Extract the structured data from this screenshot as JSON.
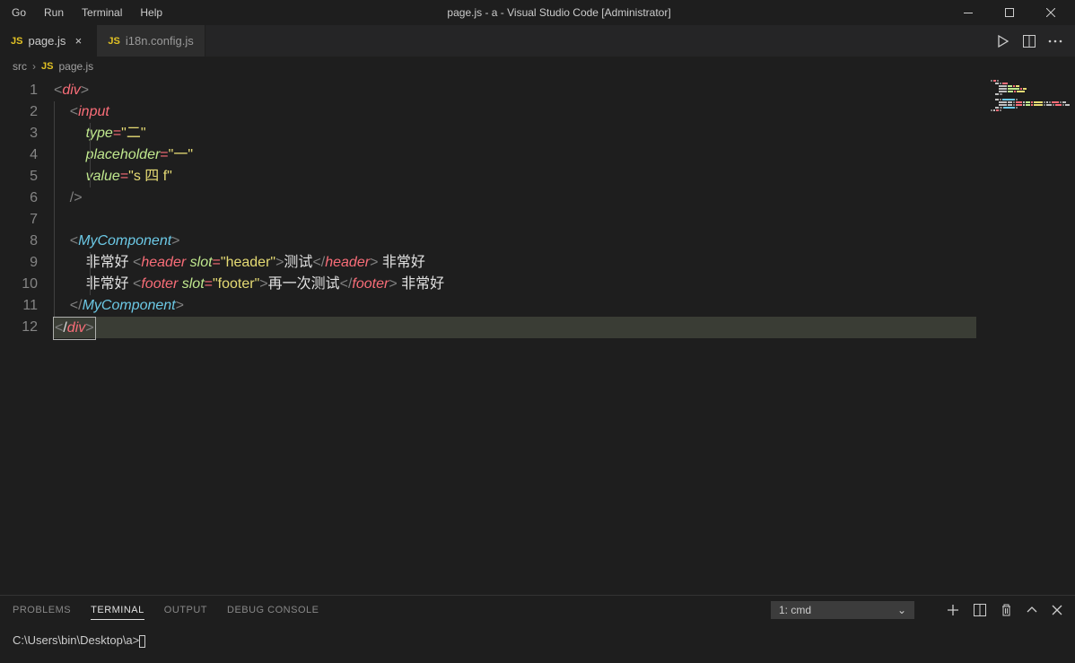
{
  "menubar": {
    "items": [
      "Go",
      "Run",
      "Terminal",
      "Help"
    ],
    "title": "page.js - a - Visual Studio Code [Administrator]"
  },
  "tabs": [
    {
      "icon": "JS",
      "label": "page.js",
      "active": true,
      "dirty": false
    },
    {
      "icon": "JS",
      "label": "i18n.config.js",
      "active": false,
      "dirty": false
    }
  ],
  "breadcrumb": {
    "root": "src",
    "file": "page.js",
    "fileIcon": "JS"
  },
  "code": {
    "lines": [
      {
        "n": 1,
        "tokens": [
          [
            "b",
            "<"
          ],
          [
            "tag-red",
            "div"
          ],
          [
            "b",
            ">"
          ]
        ]
      },
      {
        "n": 2,
        "indent": 1,
        "tokens": [
          [
            "txt",
            "    "
          ],
          [
            "b",
            "<"
          ],
          [
            "tag-red",
            "input"
          ]
        ]
      },
      {
        "n": 3,
        "indent": 2,
        "tokens": [
          [
            "txt",
            "        "
          ],
          [
            "attr",
            "type"
          ],
          [
            "op",
            "="
          ],
          [
            "str",
            "\"二\""
          ]
        ]
      },
      {
        "n": 4,
        "indent": 2,
        "tokens": [
          [
            "txt",
            "        "
          ],
          [
            "attr",
            "placeholder"
          ],
          [
            "op",
            "="
          ],
          [
            "str",
            "\"一\""
          ]
        ]
      },
      {
        "n": 5,
        "indent": 2,
        "tokens": [
          [
            "txt",
            "        "
          ],
          [
            "attr",
            "value"
          ],
          [
            "op",
            "="
          ],
          [
            "str",
            "\"s 四 f\""
          ]
        ]
      },
      {
        "n": 6,
        "indent": 1,
        "tokens": [
          [
            "txt",
            "    "
          ],
          [
            "b",
            "/>"
          ]
        ]
      },
      {
        "n": 7,
        "indent": 1,
        "tokens": []
      },
      {
        "n": 8,
        "indent": 1,
        "tokens": [
          [
            "txt",
            "    "
          ],
          [
            "b",
            "<"
          ],
          [
            "tag-blue",
            "MyComponent"
          ],
          [
            "b",
            ">"
          ]
        ]
      },
      {
        "n": 9,
        "indent": 2,
        "tokens": [
          [
            "txt",
            "        "
          ],
          [
            "txt",
            "非常好 "
          ],
          [
            "b",
            "<"
          ],
          [
            "tag-red",
            "header"
          ],
          [
            "txt",
            " "
          ],
          [
            "attr",
            "slot"
          ],
          [
            "op",
            "="
          ],
          [
            "str",
            "\"header\""
          ],
          [
            "b",
            ">"
          ],
          [
            "txt",
            "测试"
          ],
          [
            "b",
            "</"
          ],
          [
            "tag-red",
            "header"
          ],
          [
            "b",
            ">"
          ],
          [
            "txt",
            " 非常好"
          ]
        ]
      },
      {
        "n": 10,
        "indent": 2,
        "tokens": [
          [
            "txt",
            "        "
          ],
          [
            "txt",
            "非常好 "
          ],
          [
            "b",
            "<"
          ],
          [
            "tag-red",
            "footer"
          ],
          [
            "txt",
            " "
          ],
          [
            "attr",
            "slot"
          ],
          [
            "op",
            "="
          ],
          [
            "str",
            "\"footer\""
          ],
          [
            "b",
            ">"
          ],
          [
            "txt",
            "再一次测试"
          ],
          [
            "b",
            "</"
          ],
          [
            "tag-red",
            "footer"
          ],
          [
            "b",
            ">"
          ],
          [
            "txt",
            " 非常好"
          ]
        ]
      },
      {
        "n": 11,
        "indent": 1,
        "tokens": [
          [
            "txt",
            "    "
          ],
          [
            "b",
            "</"
          ],
          [
            "tag-blue",
            "MyComponent"
          ],
          [
            "b",
            ">"
          ]
        ]
      },
      {
        "n": 12,
        "selected": true,
        "boxed": true,
        "tokens": [
          [
            "b",
            "<"
          ],
          [
            "txt",
            "/"
          ],
          [
            "tag-red",
            "div"
          ],
          [
            "b",
            ">"
          ]
        ]
      }
    ]
  },
  "panel": {
    "tabs": [
      "PROBLEMS",
      "TERMINAL",
      "OUTPUT",
      "DEBUG CONSOLE"
    ],
    "activeTab": "TERMINAL",
    "terminalSelect": "1: cmd",
    "prompt": "C:\\Users\\bin\\Desktop\\a>"
  }
}
